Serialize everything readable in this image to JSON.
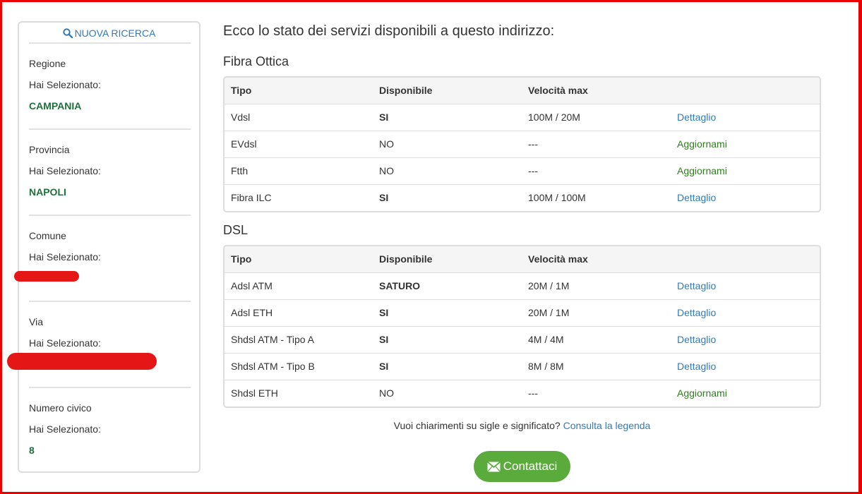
{
  "sidebar": {
    "new_search_label": "NUOVA RICERCA",
    "selected_label": "Hai Selezionato:",
    "sections": [
      {
        "label": "Regione",
        "value": "CAMPANIA"
      },
      {
        "label": "Provincia",
        "value": "NAPOLI"
      },
      {
        "label": "Comune",
        "value": ""
      },
      {
        "label": "Via",
        "value": ""
      },
      {
        "label": "Numero civico",
        "value": "8"
      }
    ]
  },
  "main": {
    "heading": "Ecco lo stato dei servizi disponibili a questo indirizzo:",
    "columns": [
      "Tipo",
      "Disponibile",
      "Velocità max"
    ],
    "fibra": {
      "title": "Fibra Ottica",
      "rows": [
        {
          "tipo": "Vdsl",
          "disponibile": "SI",
          "velocita": "100M / 20M",
          "action": "Dettaglio"
        },
        {
          "tipo": "EVdsl",
          "disponibile": "NO",
          "velocita": "---",
          "action": "Aggiornami"
        },
        {
          "tipo": "Ftth",
          "disponibile": "NO",
          "velocita": "---",
          "action": "Aggiornami"
        },
        {
          "tipo": "Fibra ILC",
          "disponibile": "SI",
          "velocita": "100M / 100M",
          "action": "Dettaglio"
        }
      ]
    },
    "dsl": {
      "title": "DSL",
      "rows": [
        {
          "tipo": "Adsl ATM",
          "disponibile": "SATURO",
          "velocita": "20M / 1M",
          "action": "Dettaglio"
        },
        {
          "tipo": "Adsl ETH",
          "disponibile": "SI",
          "velocita": "20M / 1M",
          "action": "Dettaglio"
        },
        {
          "tipo": "Shdsl ATM - Tipo A",
          "disponibile": "SI",
          "velocita": "4M / 4M",
          "action": "Dettaglio"
        },
        {
          "tipo": "Shdsl ATM - Tipo B",
          "disponibile": "SI",
          "velocita": "8M / 8M",
          "action": "Dettaglio"
        },
        {
          "tipo": "Shdsl ETH",
          "disponibile": "NO",
          "velocita": "---",
          "action": "Aggiornami"
        }
      ]
    },
    "legend_text": "Vuoi chiarimenti su sigle e significato?",
    "legend_link": "Consulta la legenda",
    "contact_label": "Contattaci"
  },
  "colors": {
    "frame": "#ee0000",
    "link": "#337ab7",
    "action_green": "#2e7d1e",
    "selected_value": "#1e6f3a",
    "button": "#5aab3c"
  },
  "icons": {
    "search": "search-icon",
    "envelope": "envelope-icon"
  }
}
